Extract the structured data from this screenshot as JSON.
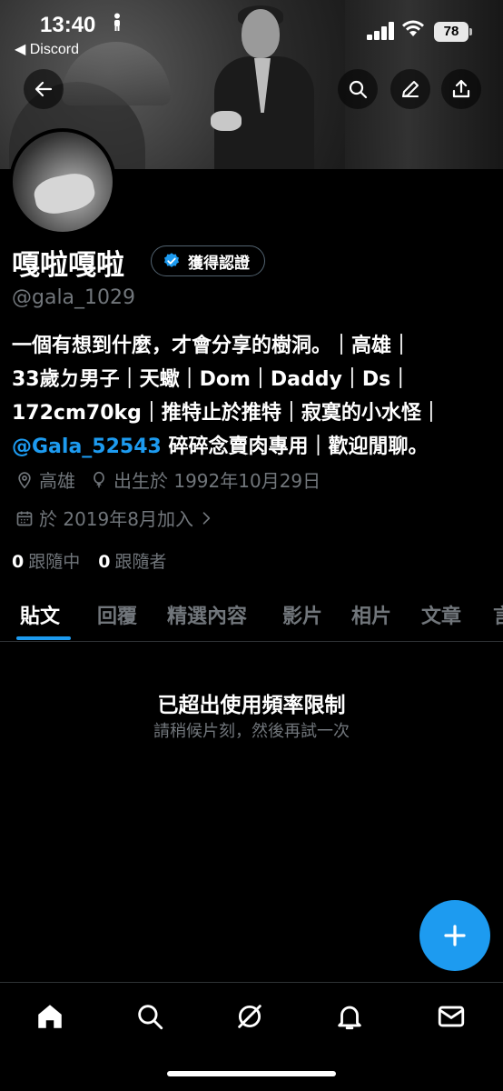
{
  "status_bar": {
    "time": "13:40",
    "back_app": "◀ Discord",
    "battery": "78"
  },
  "profile": {
    "display_name": "嘎啦嘎啦",
    "verified_label": "獲得認證",
    "handle": "@gala_1029",
    "bio_line1": "一個有想到什麼，才會分享的樹洞。｜高雄｜",
    "bio_line2": "33歲ㄉ男子｜天蠍｜Dom｜Daddy｜Ds｜",
    "bio_line3": "172cm70kg｜推特止於推特｜寂寞的小水怪｜",
    "bio_mention": "@Gala_52543",
    "bio_line4_rest": " 碎碎念賣肉專用｜歡迎閒聊。",
    "location": "高雄",
    "birthday": "出生於 1992年10月29日",
    "joined": "於 2019年8月加入",
    "following_count": "0",
    "following_label": "跟隨中",
    "followers_count": "0",
    "followers_label": "跟隨者"
  },
  "tabs": [
    {
      "label": "貼文"
    },
    {
      "label": "回覆"
    },
    {
      "label": "精選內容"
    },
    {
      "label": "影片"
    },
    {
      "label": "相片"
    },
    {
      "label": "文章"
    },
    {
      "label": "言"
    }
  ],
  "rate_limit": {
    "title": "已超出使用頻率限制",
    "subtitle": "請稍候片刻，然後再試一次"
  },
  "colors": {
    "accent": "#1d9bf0",
    "background": "#000000",
    "muted_text": "#71767b"
  }
}
